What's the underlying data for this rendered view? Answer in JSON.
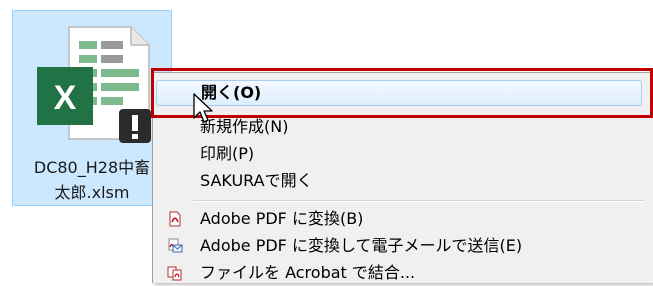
{
  "file": {
    "name_line1": "DC80_H28中畜",
    "name_line2": "太郎.xlsm",
    "icon": "excel-macro-warning-icon",
    "icon_letter": "X"
  },
  "context_menu": {
    "items": [
      {
        "label": "開く(O)",
        "default": true
      },
      {
        "label": "新規作成(N)"
      },
      {
        "label": "印刷(P)"
      },
      {
        "label": "SAKURAで開く"
      },
      {
        "label": "Adobe PDF に変換(B)",
        "icon": "pdf-convert-icon"
      },
      {
        "label": "Adobe PDF に変換して電子メールで送信(E)",
        "icon": "pdf-email-icon"
      },
      {
        "label": "ファイルを Acrobat で結合...",
        "icon": "acrobat-combine-icon"
      }
    ]
  },
  "colors": {
    "selection": "#cce8ff",
    "highlight_border": "#c00000",
    "excel_green": "#217346"
  }
}
